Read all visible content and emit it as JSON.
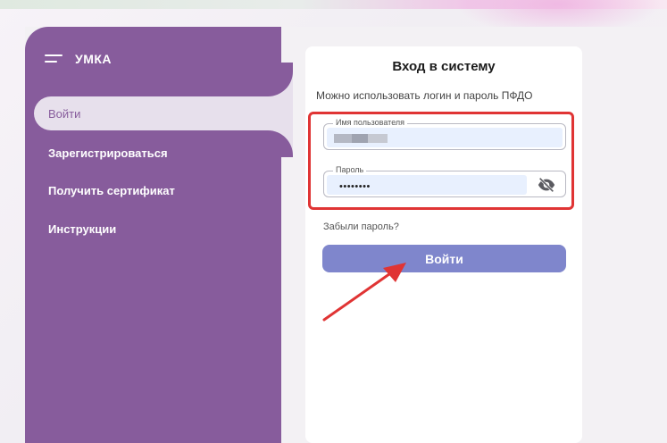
{
  "brand": {
    "name": "УМКА",
    "menu_icon": "hamburger-icon"
  },
  "sidebar": {
    "items": [
      {
        "label": "Войти",
        "active": true
      },
      {
        "label": "Зарегистрироваться",
        "active": false
      },
      {
        "label": "Получить сертификат",
        "active": false
      },
      {
        "label": "Инструкции",
        "active": false
      }
    ]
  },
  "login": {
    "title": "Вход в систему",
    "hint": "Можно использовать логин и пароль ПФДО",
    "username_label": "Имя пользователя",
    "password_label": "Пароль",
    "password_value": "••••••••",
    "forgot_link": "Забыли пароль?",
    "submit_label": "Войти",
    "visibility_icon": "eye-off-icon"
  },
  "colors": {
    "sidebar": "#875c9c",
    "active_item_bg": "#e7e0ec",
    "button": "#7f86cc",
    "highlight_frame": "#e03434",
    "annotation_arrow": "#e03434"
  }
}
